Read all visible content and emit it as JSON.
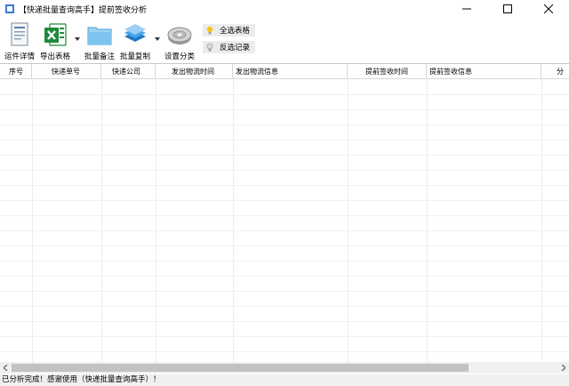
{
  "window": {
    "title": "【快递批量查询高手】提前签收分析"
  },
  "toolbar": {
    "buttons": [
      {
        "label": "运件详情",
        "icon": "document-icon"
      },
      {
        "label": "导出表格",
        "icon": "excel-icon"
      },
      {
        "label": "批量备注",
        "icon": "folder-icon"
      },
      {
        "label": "批量复制",
        "icon": "layers-icon"
      },
      {
        "label": "设置分类",
        "icon": "disk-icon"
      }
    ],
    "select_all_label": "全选表格",
    "invert_select_label": "反选记录"
  },
  "table": {
    "columns": [
      "序号",
      "快递单号",
      "快递公司",
      "发出物流时间",
      "发出物流信息",
      "提前签收时间",
      "提前签收信息",
      "分"
    ],
    "rows": []
  },
  "status": {
    "text": "已分析完成！感谢使用（快递批量查询高手）！"
  },
  "colors": {
    "excel_green": "#1d8a3b",
    "folder_blue": "#7cc4ee",
    "layers_blue": "#1f77c9",
    "gridline": "#d8d8d8"
  }
}
